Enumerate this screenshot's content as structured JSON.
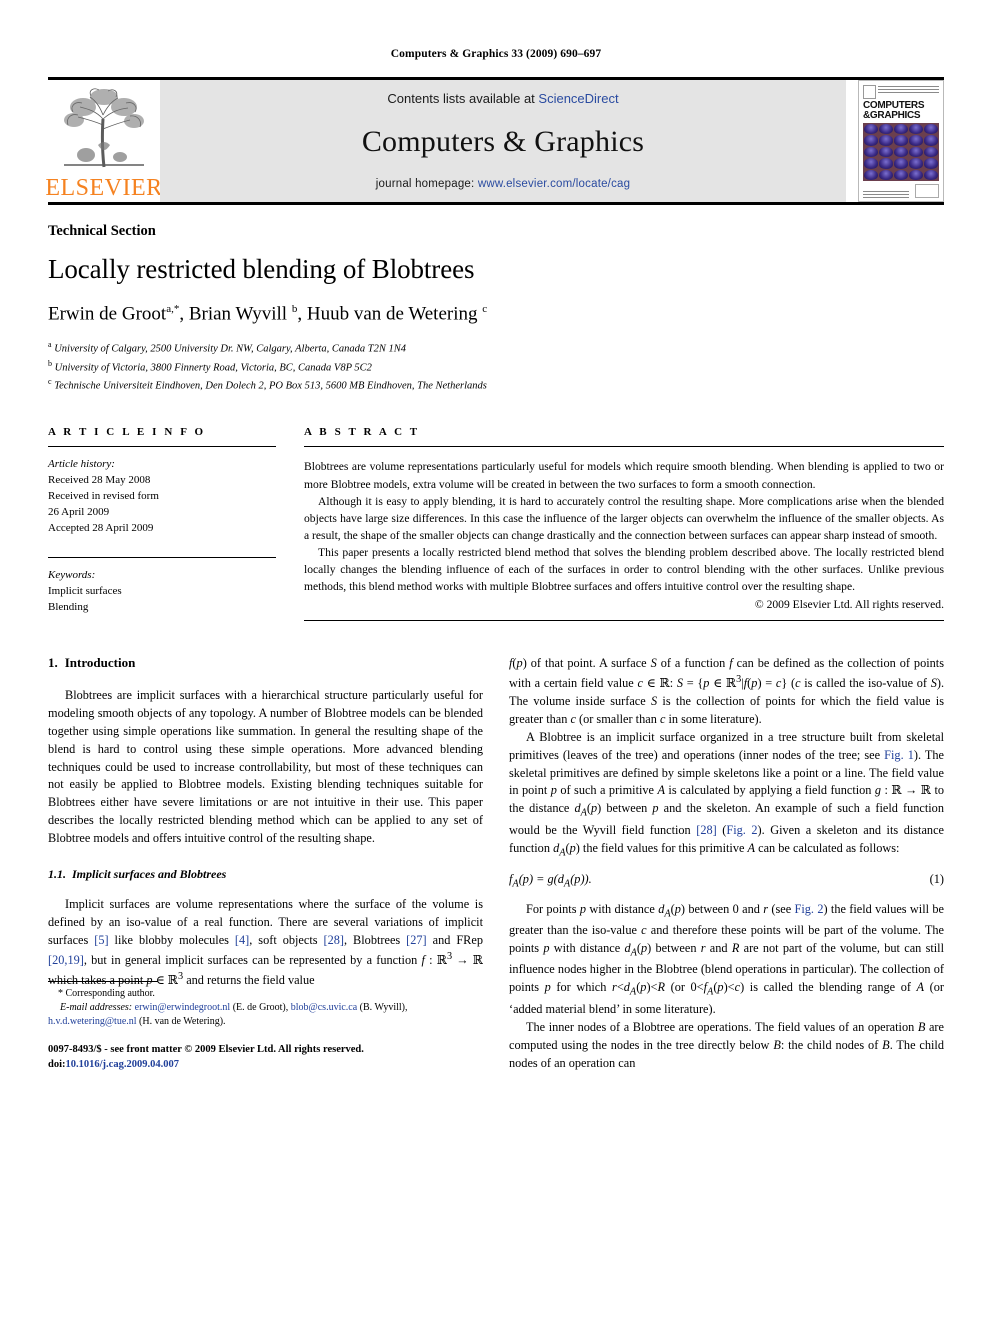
{
  "running_head": "Computers & Graphics 33 (2009) 690–697",
  "masthead": {
    "publisher_name": "ELSEVIER",
    "contents_prefix": "Contents lists available at ",
    "contents_link": "ScienceDirect",
    "journal_title": "Computers & Graphics",
    "homepage_prefix": "journal homepage: ",
    "homepage_link": "www.elsevier.com/locate/cag",
    "cover": {
      "line1": "COMPUTERS",
      "line2": "&GRAPHICS"
    },
    "colors": {
      "elsevier_orange": "#F58220",
      "link_blue": "#2a4ba0",
      "band_gray": "#e4e4e4"
    }
  },
  "title_block": {
    "kicker": "Technical Section",
    "title": "Locally restricted blending of Blobtrees",
    "authors_html": "Erwin de Groot<sup>a,*</sup>, Brian Wyvill <sup>b</sup>, Huub van de Wetering <sup>c</sup>",
    "affiliations": [
      {
        "marker": "a",
        "text": "University of Calgary, 2500 University Dr. NW, Calgary, Alberta, Canada T2N 1N4"
      },
      {
        "marker": "b",
        "text": "University of Victoria, 3800 Finnerty Road, Victoria, BC, Canada V8P 5C2"
      },
      {
        "marker": "c",
        "text": "Technische Universiteit Eindhoven, Den Dolech 2, PO Box 513, 5600 MB Eindhoven, The Netherlands"
      }
    ]
  },
  "article_info": {
    "heading": "A R T I C L E    I N F O",
    "history_title": "Article history:",
    "history_lines": [
      "Received 28 May 2008",
      "Received in revised form",
      "26 April 2009",
      "Accepted 28 April 2009"
    ],
    "keywords_title": "Keywords:",
    "keywords": [
      "Implicit surfaces",
      "Blending"
    ]
  },
  "abstract": {
    "heading": "A B S T R A C T",
    "paragraphs": [
      "Blobtrees are volume representations particularly useful for models which require smooth blending. When blending is applied to two or more Blobtree models, extra volume will be created in between the two surfaces to form a smooth connection.",
      "Although it is easy to apply blending, it is hard to accurately control the resulting shape. More complications arise when the blended objects have large size differences. In this case the influence of the larger objects can overwhelm the influence of the smaller objects. As a result, the shape of the smaller objects can change drastically and the connection between surfaces can appear sharp instead of smooth.",
      "This paper presents a locally restricted blend method that solves the blending problem described above. The locally restricted blend locally changes the blending influence of each of the surfaces in order to control blending with the other surfaces. Unlike previous methods, this blend method works with multiple Blobtree surfaces and offers intuitive control over the resulting shape."
    ],
    "copyright": "© 2009 Elsevier Ltd. All rights reserved."
  },
  "body": {
    "section1": {
      "number": "1.",
      "title": "Introduction",
      "paragraph1": "Blobtrees are implicit surfaces with a hierarchical structure particularly useful for modeling smooth objects of any topology. A number of Blobtree models can be blended together using simple operations like summation. In general the resulting shape of the blend is hard to control using these simple operations. More advanced blending techniques could be used to increase controllability, but most of these techniques can not easily be applied to Blobtree models. Existing blending techniques suitable for Blobtrees either have severe limitations or are not intuitive in their use. This paper describes the locally restricted blending method which can be applied to any set of Blobtree models and offers intuitive control of the resulting shape."
    },
    "subsection11": {
      "number": "1.1.",
      "title": "Implicit surfaces and Blobtrees"
    },
    "equation1": {
      "number": "(1)"
    }
  },
  "footnote": {
    "corresponding": "Corresponding author.",
    "email_label": "E-mail addresses:",
    "emails": [
      {
        "address": "erwin@erwindegroot.nl",
        "owner": "(E. de Groot)"
      },
      {
        "address": "blob@cs.uvic.ca",
        "owner": "(B. Wyvill)"
      },
      {
        "address": "h.v.d.wetering@tue.nl",
        "owner": "(H. van de Wetering)"
      }
    ]
  },
  "imprint": {
    "line1": "0097-8493/$ - see front matter © 2009 Elsevier Ltd. All rights reserved.",
    "doi_label": "doi:",
    "doi_value": "10.1016/j.cag.2009.04.007"
  }
}
